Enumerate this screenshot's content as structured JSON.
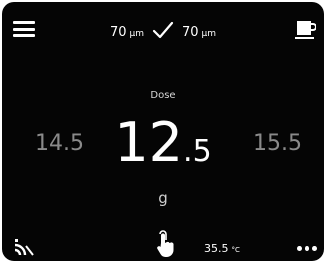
{
  "top_bar": {
    "menu_icon": "hamburger-menu-icon",
    "grind_left_value": "70",
    "grind_left_unit": "µm",
    "sync_icon": "checkmark-icon",
    "grind_right_value": "70",
    "grind_right_unit": "µm",
    "cup_icon": "coffee-cup-icon"
  },
  "dose": {
    "label": "Dose",
    "prev_value": "14.5",
    "current_int": "12",
    "current_dec": ".5",
    "next_value": "15.5",
    "unit": "g"
  },
  "bottom_bar": {
    "signal_icon": "wireless-signal-icon",
    "touch_icon": "touch-hand-icon",
    "temperature_value": "35.5",
    "temperature_unit": "°C",
    "more_icon": "more-options-icon"
  },
  "colors": {
    "background": "#050505",
    "text": "#ffffff",
    "muted": "#8a8a8a"
  }
}
